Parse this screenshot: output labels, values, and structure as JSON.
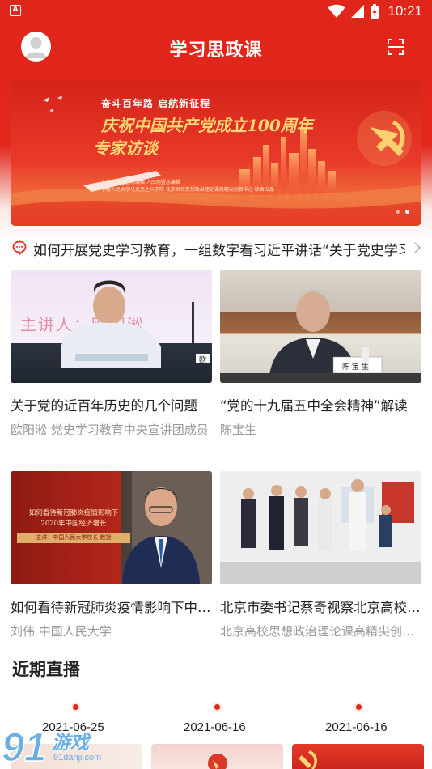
{
  "status_bar": {
    "app_badge": "A",
    "time": "10:21"
  },
  "header": {
    "title": "学习思政课",
    "avatar_icon": "user-avatar-icon",
    "scan_icon": "scan-icon"
  },
  "banner": {
    "subtitle": "奋斗百年路  启航新征程",
    "title_line1": "庆祝中国共产党成立100周年",
    "title_line2": "专家访谈",
    "fine_print_1": "人民出版社暨总编辑 人民网暨总编辑",
    "fine_print_2": "学者人民大学马克思主义学院 北京高校思想政治理论课高精尖创新中心 联合出品",
    "dot_count": 2,
    "active_dot": 1
  },
  "notice": {
    "text": "如何开展党史学习教育，一组数字看习近平讲话“关于党史学习教育”"
  },
  "cards": [
    {
      "title": "关于党的近百年历史的几个问题",
      "subtitle": "欧阳淞 党史学习教育中央宣讲团成员",
      "thumb_text": "主讲人：欧阳淞",
      "nameplate": "欧"
    },
    {
      "title": "“党的十九届五中全会精神”解读",
      "subtitle": "陈宝生",
      "nameplate": "陈 宝 生"
    },
    {
      "title": "如何看待新冠肺炎疫情影响下中国经济增长",
      "subtitle": "刘伟  中国人民大学",
      "thumb_line1": "如何看待新冠肺炎疫情影响下",
      "thumb_line2": "2020年中国经济增长",
      "thumb_line3": "主讲：中国人民大学校长 教授"
    },
    {
      "title": "北京市委书记蔡奇视察北京高校思想政治理论课高精尖创新中心",
      "subtitle": "北京高校思想政治理论课高精尖创新中心"
    }
  ],
  "live": {
    "section_title": "近期直播",
    "dates": [
      "2021-06-25",
      "2021-06-16",
      "2021-06-16"
    ]
  },
  "watermark": {
    "text": "游戏",
    "url": "91danji.com"
  },
  "colors": {
    "primary": "#e2281c",
    "banner_gold": "#ffd874",
    "subtext": "#999999"
  }
}
